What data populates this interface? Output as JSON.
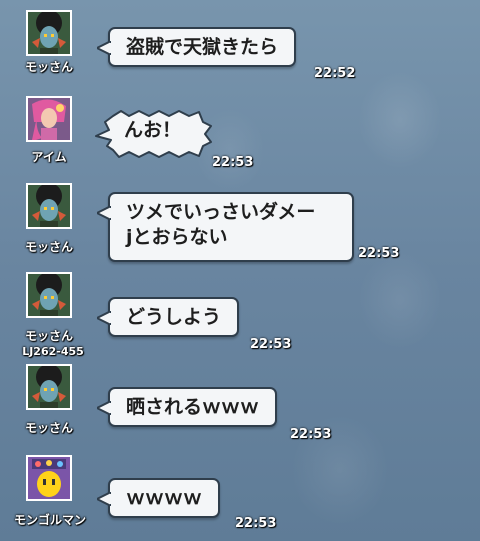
{
  "messages": [
    {
      "sender": "モッさん",
      "sender_sub": "",
      "text": "盗賊で天獄きたら",
      "time": "22:52"
    },
    {
      "sender": "アイム",
      "sender_sub": "",
      "text": "んお！",
      "time": "22:53"
    },
    {
      "sender": "モッさん",
      "sender_sub": "",
      "text_line1": "ツメでいっさいダメー",
      "text_line2": "jとおらない",
      "time": "22:53"
    },
    {
      "sender": "モッさん",
      "sender_sub": "LJ262-455",
      "text": "どうしよう",
      "time": "22:53"
    },
    {
      "sender": "モッさん",
      "sender_sub": "",
      "text": "晒されるｗｗｗ",
      "time": "22:53"
    },
    {
      "sender": "モンゴルマン",
      "sender_sub": "",
      "text": "ｗｗｗｗ",
      "time": "22:53"
    }
  ]
}
